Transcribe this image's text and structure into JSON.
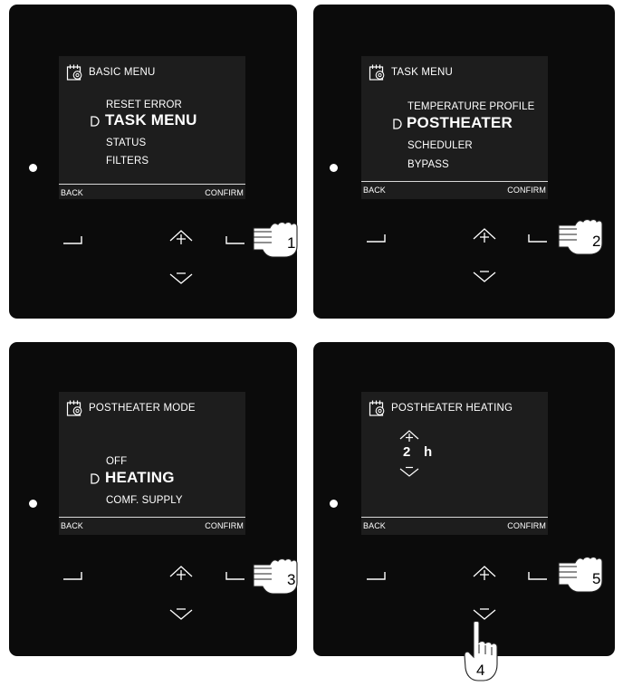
{
  "colors": {
    "panel": "#0b0b0b",
    "screen": "#1d1d1d",
    "text": "#ffffff",
    "paper": "#ffffff"
  },
  "panels": [
    {
      "title": "BASIC MENU",
      "items": [
        "RESET ERROR",
        "TASK MENU",
        "STATUS",
        "FILTERS"
      ],
      "selected": "TASK MENU",
      "footer": {
        "left": "BACK",
        "right": "CONFIRM"
      },
      "step": "1"
    },
    {
      "title": "TASK MENU",
      "items": [
        "TEMPERATURE PROFILE",
        "POSTHEATER",
        "SCHEDULER",
        "BYPASS"
      ],
      "selected": "POSTHEATER",
      "footer": {
        "left": "BACK",
        "right": "CONFIRM"
      },
      "step": "2"
    },
    {
      "title": "POSTHEATER MODE",
      "items": [
        "OFF",
        "HEATING",
        "COMF. SUPPLY"
      ],
      "selected": "HEATING",
      "footer": {
        "left": "BACK",
        "right": "CONFIRM"
      },
      "step": "3"
    },
    {
      "title": "POSTHEATER HEATING",
      "value": "2",
      "unit": "h",
      "footer": {
        "left": "BACK",
        "right": "CONFIRM"
      },
      "step_confirm": "5",
      "step_down": "4"
    }
  ],
  "icons": [
    "menu-calendar-gear-icon",
    "plus-up-icon",
    "minus-down-icon",
    "pointing-hand-icon"
  ]
}
